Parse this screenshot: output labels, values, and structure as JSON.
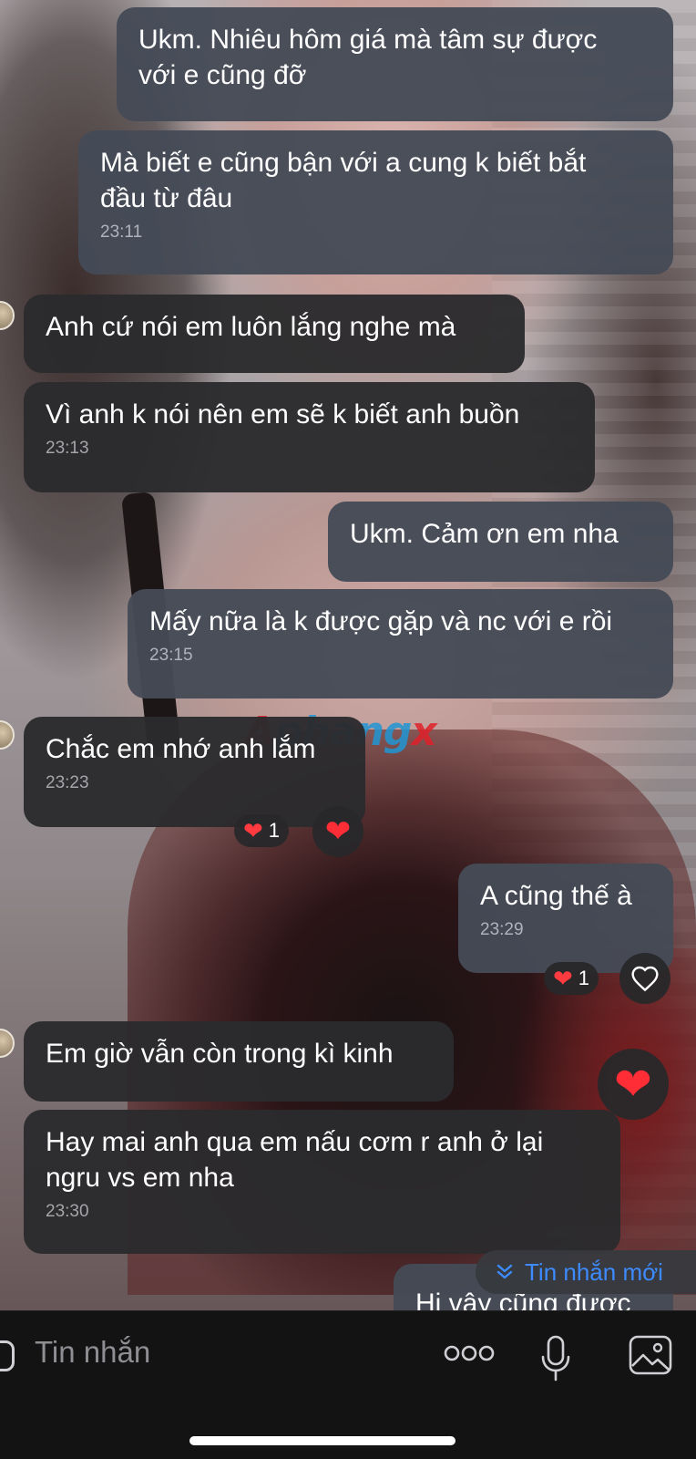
{
  "messages": [
    {
      "id": 1,
      "dir": "out",
      "text": "Ukm. Nhiêu hôm giá mà tâm sự được\nvới e cũng đỡ",
      "time": ""
    },
    {
      "id": 2,
      "dir": "out",
      "text": "Mà biết e cũng bận với a cung k biết bắt\nđầu từ đâu",
      "time": "23:11"
    },
    {
      "id": 3,
      "dir": "in",
      "text": "Anh cứ nói em luôn lắng nghe mà",
      "time": ""
    },
    {
      "id": 4,
      "dir": "in",
      "text": "Vì anh k nói nên em sẽ k biết anh buồn",
      "time": "23:13"
    },
    {
      "id": 5,
      "dir": "out",
      "text": "Ukm.  Cảm ơn em nha",
      "time": ""
    },
    {
      "id": 6,
      "dir": "out",
      "text": "Mấy nữa là k được gặp và nc với e rồi",
      "time": "23:15"
    },
    {
      "id": 7,
      "dir": "in",
      "text": "Chắc em nhớ anh lắm",
      "time": "23:23",
      "reaction_count": "1"
    },
    {
      "id": 8,
      "dir": "out",
      "text": "A cũng thế à",
      "time": "23:29",
      "reaction_count": "1"
    },
    {
      "id": 9,
      "dir": "in",
      "text": "Em giờ vẫn còn trong kì kinh",
      "time": ""
    },
    {
      "id": 10,
      "dir": "in",
      "text": "Hay mai anh qua em nấu cơm r anh ở lại\nngru vs em nha",
      "time": "23:30"
    },
    {
      "id": 11,
      "dir": "out",
      "text": "Hi vây cũng được",
      "time": ""
    }
  ],
  "new_messages_label": "Tin nhắn mới",
  "composer": {
    "placeholder": "Tin nhắn"
  },
  "watermark": {
    "part1": "A",
    "part2": "phang",
    "part3": "x"
  },
  "colors": {
    "outgoing_bubble": "#454B56",
    "incoming_bubble": "#2B2B2D",
    "accent": "#3D8BFF",
    "heart": "#FF3B40"
  },
  "icons": [
    "heart-icon",
    "heart-outline-icon",
    "chevron-double-down-icon",
    "camera-icon",
    "more-icon",
    "microphone-icon",
    "image-icon"
  ]
}
